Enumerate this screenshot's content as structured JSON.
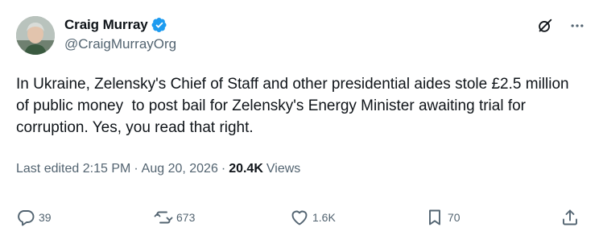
{
  "author": {
    "display_name": "Craig Murray",
    "handle": "@CraigMurrayOrg"
  },
  "icons": {
    "verified": "verified-badge-icon",
    "grok": "grok-icon",
    "more": "more-icon",
    "reply": "reply-icon",
    "repost": "repost-icon",
    "like": "like-icon",
    "bookmark": "bookmark-icon",
    "share": "share-icon"
  },
  "colors": {
    "verified": "#1d9bf0",
    "secondary_text": "#536471",
    "primary_text": "#0f1419"
  },
  "tweet": {
    "text": "In Ukraine, Zelensky's Chief of Staff and other presidential aides stole £2.5 million of public money  to post bail for Zelensky's Energy Minister awaiting trial for corruption. Yes, you read that right."
  },
  "meta": {
    "edited_label": "Last edited",
    "time": "2:15 PM",
    "separator": "·",
    "date": "Aug 20, 2026",
    "views_count": "20.4K",
    "views_label": "Views"
  },
  "actions": {
    "replies": "39",
    "reposts": "673",
    "likes": "1.6K",
    "bookmarks": "70"
  }
}
